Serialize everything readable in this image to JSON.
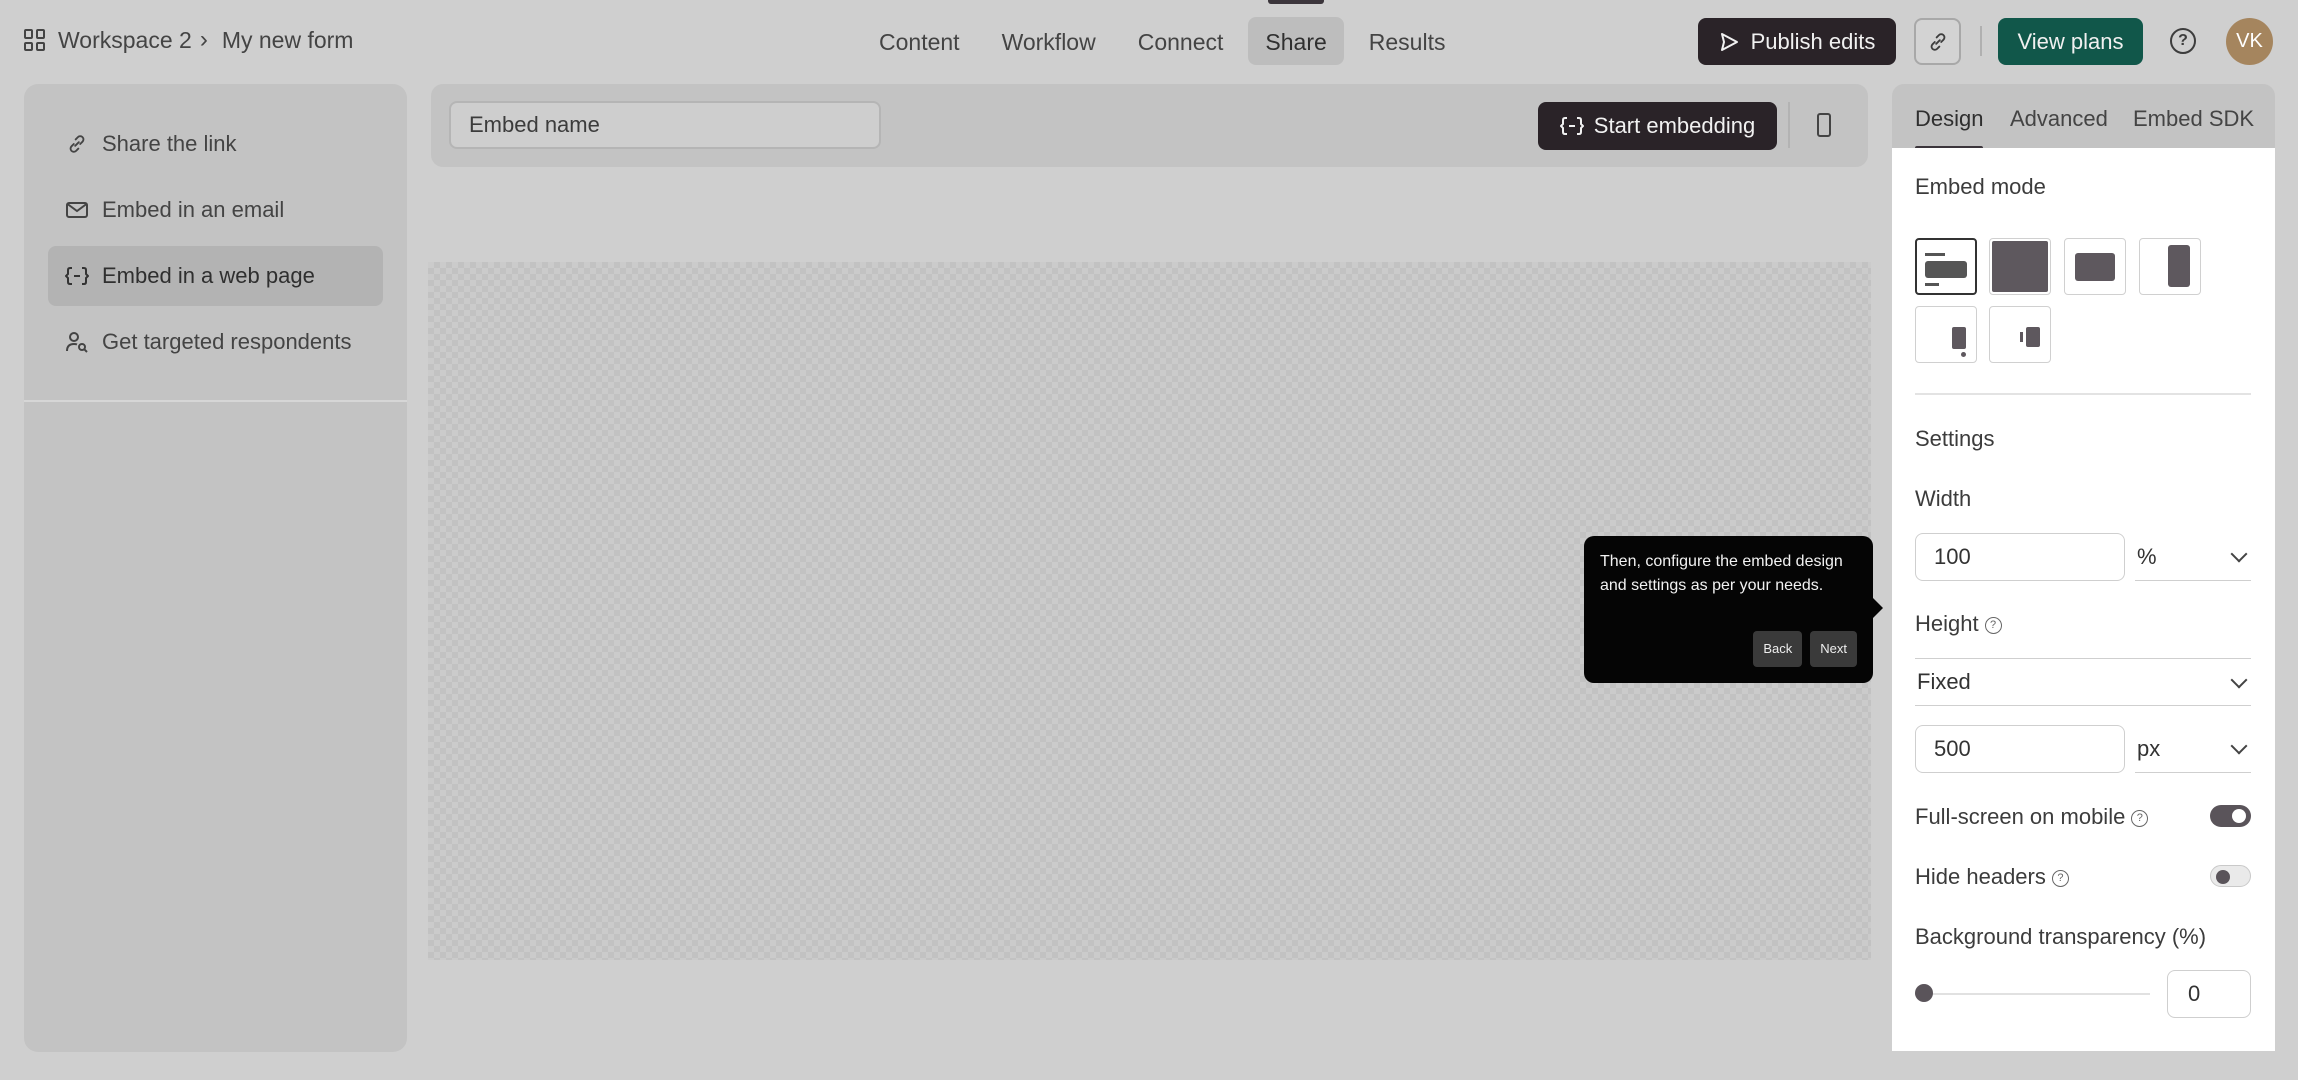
{
  "breadcrumb": {
    "workspace": "Workspace 2",
    "separator": "›",
    "form": "My new form"
  },
  "topnav": {
    "tabs": [
      "Content",
      "Workflow",
      "Connect",
      "Share",
      "Results"
    ],
    "active": "Share"
  },
  "header_actions": {
    "publish": "Publish edits",
    "view_plans": "View plans",
    "help": "?",
    "avatar_initials": "VK"
  },
  "sidebar": {
    "items": [
      {
        "label": "Share the link",
        "icon": "link-icon"
      },
      {
        "label": "Embed in an email",
        "icon": "mail-icon"
      },
      {
        "label": "Embed in a web page",
        "icon": "embed-code-icon"
      },
      {
        "label": "Get targeted respondents",
        "icon": "user-search-icon"
      }
    ],
    "active_index": 2
  },
  "embed_bar": {
    "name_value": "Embed name",
    "start_button": "Start embedding"
  },
  "tooltip": {
    "text": "Then, configure the embed design and settings as per your needs.",
    "back": "Back",
    "next": "Next"
  },
  "right_panel": {
    "tabs": [
      "Design",
      "Advanced",
      "Embed SDK"
    ],
    "active_tab": "Design",
    "embed_mode_title": "Embed mode",
    "settings_title": "Settings",
    "width": {
      "label": "Width",
      "value": "100",
      "unit": "%"
    },
    "height": {
      "label": "Height",
      "mode": "Fixed",
      "value": "500",
      "unit": "px"
    },
    "fullscreen_mobile": {
      "label": "Full-screen on mobile",
      "on": true
    },
    "hide_headers": {
      "label": "Hide headers",
      "on": false
    },
    "bg_transparency": {
      "label": "Background transparency (%)",
      "value": "0"
    }
  },
  "colors": {
    "dark_button": "#2a2328",
    "plans_button": "#11574a",
    "avatar": "#a5855e"
  }
}
